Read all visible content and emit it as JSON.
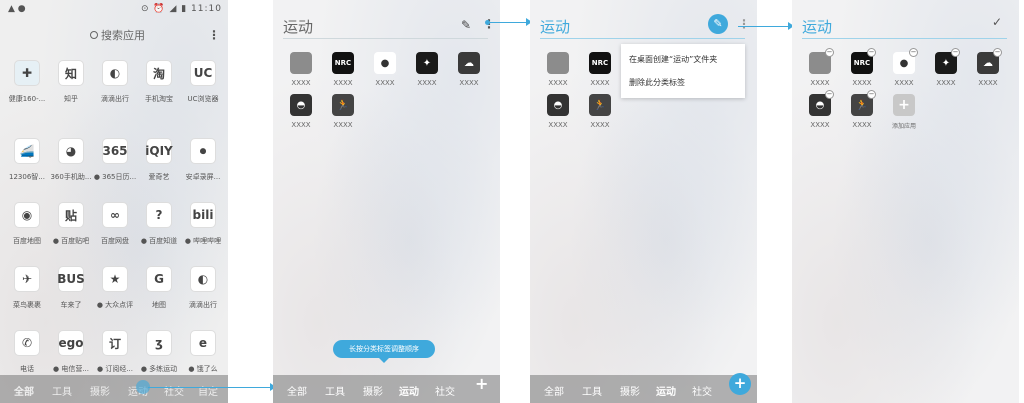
{
  "screen1": {
    "status": {
      "left": "▲ ●",
      "right": "⊙ ⏰ ◢ ▮ 11:10"
    },
    "search_placeholder": "搜索应用",
    "apps": [
      {
        "label": "健康160-...",
        "glyph": "✚"
      },
      {
        "label": "知乎",
        "glyph": "知"
      },
      {
        "label": "滴滴出行",
        "glyph": "◐"
      },
      {
        "label": "手机淘宝",
        "glyph": "淘"
      },
      {
        "label": "UC浏览器",
        "glyph": "UC"
      },
      {
        "label": "12306智...",
        "glyph": "🚄"
      },
      {
        "label": "360手机助...",
        "glyph": "◕"
      },
      {
        "label": "● 365日历...",
        "glyph": "365"
      },
      {
        "label": "爱奇艺",
        "glyph": "iQIY"
      },
      {
        "label": "安卓录屏...",
        "glyph": "⏺"
      },
      {
        "label": "百度地图",
        "glyph": "◉"
      },
      {
        "label": "● 百度贴吧",
        "glyph": "贴"
      },
      {
        "label": "百度网盘",
        "glyph": "∞"
      },
      {
        "label": "● 百度知道",
        "glyph": "?"
      },
      {
        "label": "● 哔哩哔哩",
        "glyph": "bili"
      },
      {
        "label": "菜鸟裹裹",
        "glyph": "✈"
      },
      {
        "label": "车来了",
        "glyph": "BUS"
      },
      {
        "label": "● 大众点评",
        "glyph": "★"
      },
      {
        "label": "地图",
        "glyph": "G"
      },
      {
        "label": "滴滴出行",
        "glyph": "◐"
      },
      {
        "label": "电话",
        "glyph": "✆"
      },
      {
        "label": "● 电信营...",
        "glyph": "ego"
      },
      {
        "label": "● 订阅经...",
        "glyph": "订"
      },
      {
        "label": "● 多练运动",
        "glyph": "ʒ"
      },
      {
        "label": "● 饿了么",
        "glyph": "e"
      }
    ],
    "dock_tabs": [
      "全部",
      "工具",
      "摄影",
      "运动",
      "社交",
      "自定"
    ]
  },
  "screen2": {
    "title": "运动",
    "apps": [
      {
        "label": "XXXX",
        "color": "#8c8c8c"
      },
      {
        "label": "XXXX",
        "color": "#111111",
        "glyph": "NRC"
      },
      {
        "label": "XXXX",
        "color": "#ffffff",
        "glyph": "●"
      },
      {
        "label": "XXXX",
        "color": "#1a1a1a",
        "glyph": "✦"
      },
      {
        "label": "XXXX",
        "color": "#3a3a3a",
        "glyph": "☁"
      },
      {
        "label": "XXXX",
        "color": "#333333",
        "glyph": "◓"
      },
      {
        "label": "XXXX",
        "color": "#444444",
        "glyph": "🏃"
      }
    ],
    "tooltip": "长按分类标签调整顺序",
    "dock_tabs": [
      "全部",
      "工具",
      "摄影",
      "运动",
      "社交"
    ],
    "add_label": "+"
  },
  "screen3": {
    "title": "运动",
    "menu_items": [
      "在桌面创建“运动”文件夹",
      "删除此分类标签"
    ],
    "apps": [
      {
        "label": "XXXX",
        "color": "#8c8c8c"
      },
      {
        "label": "XXXX",
        "color": "#111111",
        "glyph": "NRC"
      },
      {
        "label": "XXXX",
        "color": "#333333",
        "glyph": "◓"
      },
      {
        "label": "XXXX",
        "color": "#444444",
        "glyph": "🏃"
      }
    ],
    "dock_tabs": [
      "全部",
      "工具",
      "摄影",
      "运动",
      "社交"
    ],
    "add_label": "+"
  },
  "screen4": {
    "title": "运动",
    "apps": [
      {
        "label": "XXXX",
        "color": "#8c8c8c"
      },
      {
        "label": "XXXX",
        "color": "#111111",
        "glyph": "NRC"
      },
      {
        "label": "XXXX",
        "color": "#ffffff",
        "glyph": "●"
      },
      {
        "label": "XXXX",
        "color": "#1a1a1a",
        "glyph": "✦"
      },
      {
        "label": "XXXX",
        "color": "#3a3a3a",
        "glyph": "☁"
      },
      {
        "label": "XXXX",
        "color": "#333333",
        "glyph": "◓"
      },
      {
        "label": "XXXX",
        "color": "#444444",
        "glyph": "🏃"
      }
    ],
    "add_app_label": "添加应用",
    "add_app_glyph": "+"
  },
  "colors": {
    "accent": "#3fa9dc"
  }
}
